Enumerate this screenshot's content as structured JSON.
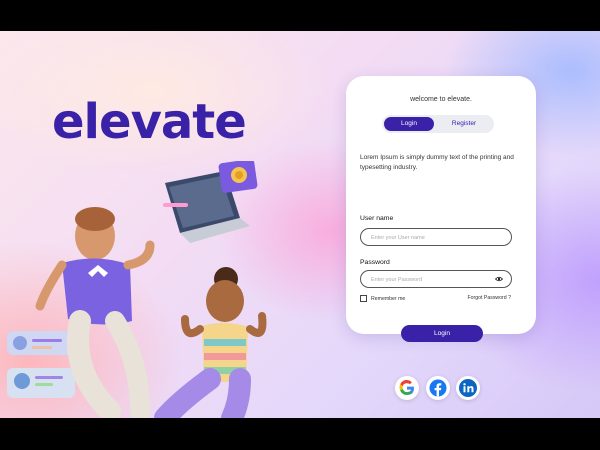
{
  "brand": {
    "name": "elevate"
  },
  "login_card": {
    "welcome": "welcome to elevate.",
    "tabs": [
      {
        "label": "Login",
        "active": true
      },
      {
        "label": "Register",
        "active": false
      }
    ],
    "description": "Lorem Ipsum is simply dummy text of the printing and typesetting industry.",
    "username": {
      "label": "User name",
      "placeholder": "Enter your User name"
    },
    "password": {
      "label": "Password",
      "placeholder": "Enter your Password"
    },
    "remember_label": "Remember me",
    "forgot_label": "Forgot Password ?",
    "login_button": "Login"
  },
  "social": [
    {
      "name": "google-icon"
    },
    {
      "name": "facebook-icon"
    },
    {
      "name": "linkedin-icon"
    }
  ],
  "colors": {
    "brand": "#3a22a8",
    "facebook": "#1877f2",
    "linkedin": "#0a66c2"
  }
}
